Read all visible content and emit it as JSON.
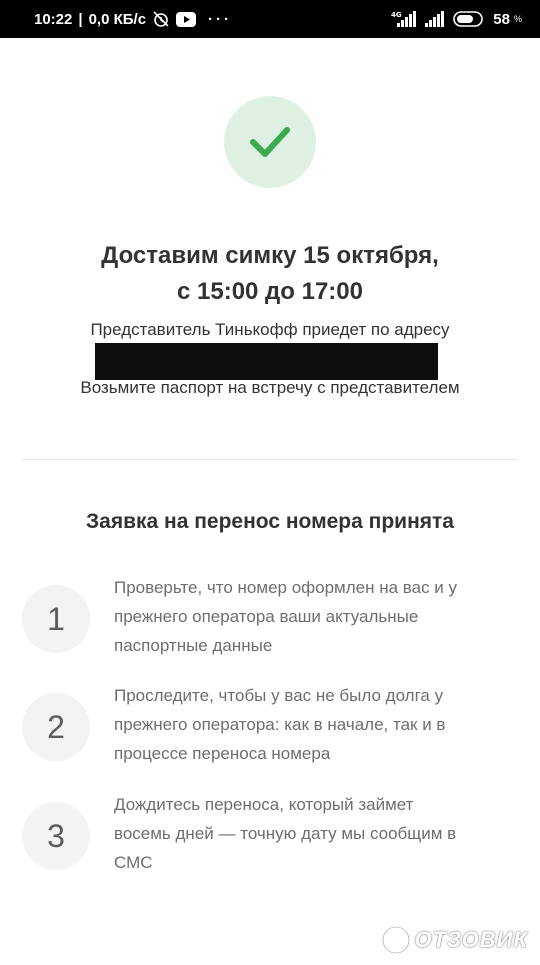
{
  "status_bar": {
    "time": "10:22",
    "speed": "0,0 КБ/с",
    "dots": "···",
    "network_type": "4G",
    "battery": "58",
    "battery_unit": "%"
  },
  "delivery": {
    "title_line1": "Доставим симку 15 октября,",
    "title_line2": "с 15:00 до 17:00",
    "subtitle": "Представитель Тинькофф приедет по адресу",
    "passport_note": "Возьмите паспорт на встречу с представителем"
  },
  "porting": {
    "title": "Заявка на перенос номера принята",
    "steps": [
      {
        "number": "1",
        "lines": [
          "Проверьте, что номер оформлен на вас и у",
          "прежнего оператора ваши актуальные",
          "паспортные данные"
        ]
      },
      {
        "number": "2",
        "lines": [
          "Проследите, чтобы у вас не было долга у",
          "прежнего оператора: как в начале, так и в",
          "процессе переноса номера"
        ]
      },
      {
        "number": "3",
        "lines": [
          "Дождитесь переноса, который займет",
          "восемь дней — точную дату мы сообщим в",
          "СМС"
        ]
      }
    ]
  },
  "watermark": {
    "text": "ОТЗОВИК"
  },
  "colors": {
    "accent_green": "#3aaa4f",
    "check_bg": "#dff1e3",
    "step_bg": "#f2f3f5"
  }
}
